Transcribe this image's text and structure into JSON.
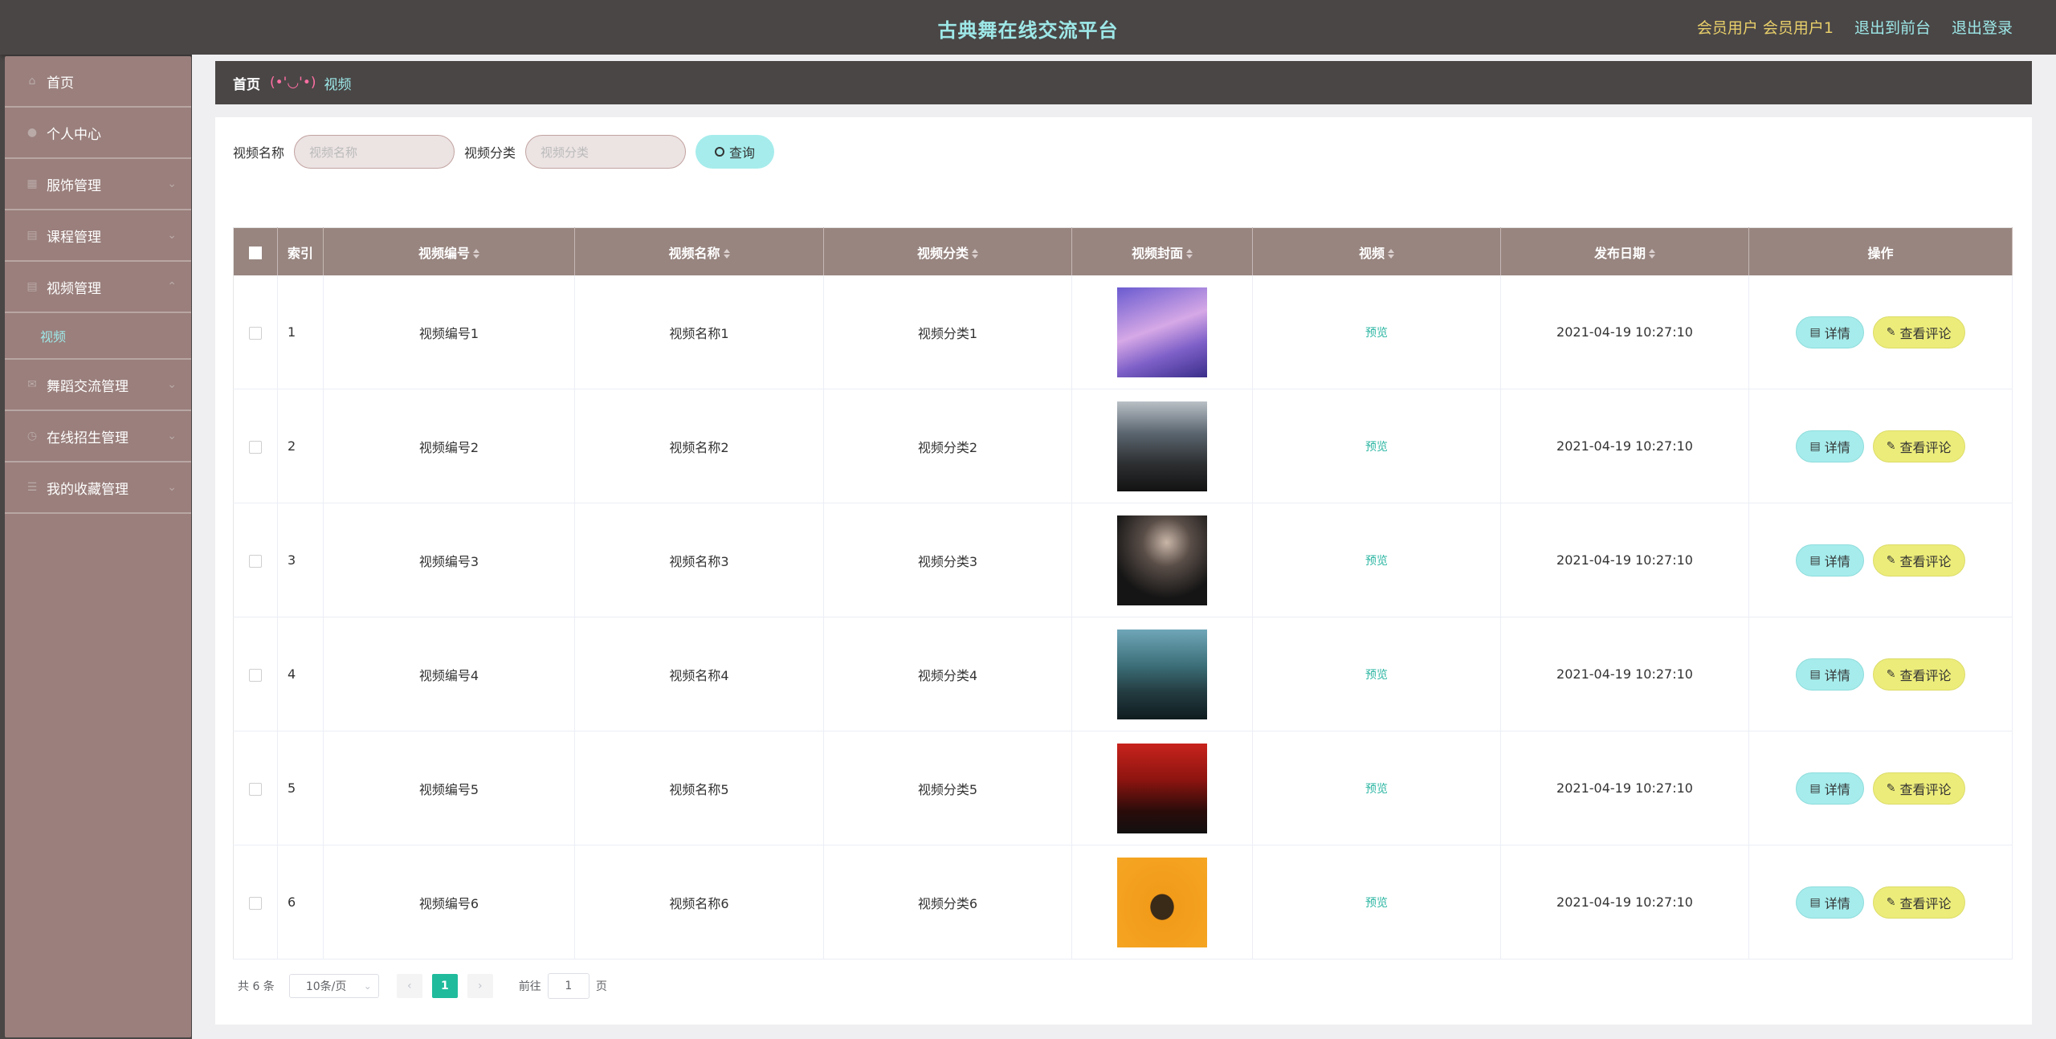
{
  "header": {
    "title": "古典舞在线交流平台",
    "user_role": "会员用户",
    "user_name": "会员用户1",
    "to_frontend": "退出到前台",
    "logout": "退出登录"
  },
  "sidebar": {
    "items": [
      {
        "label": "首页",
        "icon": "home-icon"
      },
      {
        "label": "个人中心",
        "icon": "user-icon"
      },
      {
        "label": "服饰管理",
        "icon": "grid-icon"
      },
      {
        "label": "课程管理",
        "icon": "list-icon"
      },
      {
        "label": "视频管理",
        "icon": "list-icon"
      },
      {
        "label": "舞蹈交流管理",
        "icon": "chat-icon"
      },
      {
        "label": "在线招生管理",
        "icon": "clock-icon"
      },
      {
        "label": "我的收藏管理",
        "icon": "menu-icon"
      }
    ],
    "sub_active": "视频"
  },
  "breadcrumb": {
    "home": "首页",
    "separator": "(•'◡'•)",
    "current": "视频"
  },
  "search": {
    "name_label": "视频名称",
    "name_placeholder": "视频名称",
    "category_label": "视频分类",
    "category_placeholder": "视频分类",
    "query_button": "查询"
  },
  "table": {
    "columns": [
      "索引",
      "视频编号",
      "视频名称",
      "视频分类",
      "视频封面",
      "视频",
      "发布日期",
      "操作"
    ],
    "preview_label": "预览",
    "detail_label": "详情",
    "comment_label": "查看评论",
    "rows": [
      {
        "index": "1",
        "code": "视频编号1",
        "name": "视频名称1",
        "category": "视频分类1",
        "date": "2021-04-19 10:27:10"
      },
      {
        "index": "2",
        "code": "视频编号2",
        "name": "视频名称2",
        "category": "视频分类2",
        "date": "2021-04-19 10:27:10"
      },
      {
        "index": "3",
        "code": "视频编号3",
        "name": "视频名称3",
        "category": "视频分类3",
        "date": "2021-04-19 10:27:10"
      },
      {
        "index": "4",
        "code": "视频编号4",
        "name": "视频名称4",
        "category": "视频分类4",
        "date": "2021-04-19 10:27:10"
      },
      {
        "index": "5",
        "code": "视频编号5",
        "name": "视频名称5",
        "category": "视频分类5",
        "date": "2021-04-19 10:27:10"
      },
      {
        "index": "6",
        "code": "视频编号6",
        "name": "视频名称6",
        "category": "视频分类6",
        "date": "2021-04-19 10:27:10"
      }
    ]
  },
  "pagination": {
    "total": "共 6 条",
    "page_size": "10条/页",
    "current_page": "1",
    "goto_label": "前往",
    "goto_value": "1",
    "page_unit": "页"
  },
  "colors": {
    "header_bg": "#4a4646",
    "sidebar_bg": "#9a7f7c",
    "accent_cyan": "#9ee8e8",
    "accent_yellow": "#ecec7a",
    "table_header_bg": "#988580",
    "pager_active": "#1fbb9c"
  }
}
